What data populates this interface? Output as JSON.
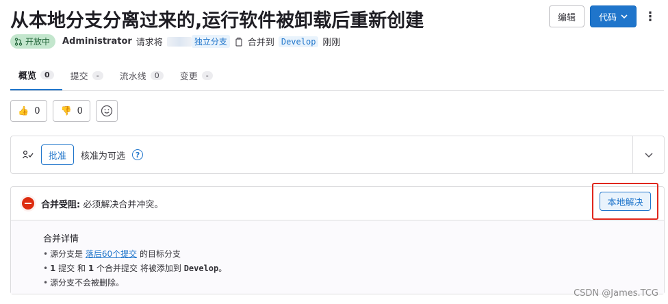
{
  "title": "从本地分支分离过来的,运行软件被卸载后重新创建",
  "header": {
    "edit_label": "编辑",
    "code_label": "代码"
  },
  "meta": {
    "status": "开放中",
    "author": "Administrator",
    "request_text": "请求将",
    "source_branch": "独立分支",
    "merge_into_text": "合并到",
    "target_branch": "Develop",
    "time": "刚刚"
  },
  "tabs": [
    {
      "label": "概览",
      "count": "0"
    },
    {
      "label": "提交",
      "count": "-"
    },
    {
      "label": "流水线",
      "count": "0"
    },
    {
      "label": "变更",
      "count": "-"
    }
  ],
  "reactions": {
    "thumbsup": "0",
    "thumbsdown": "0"
  },
  "approval": {
    "button_label": "批准",
    "text": "核准为可选"
  },
  "merge": {
    "blocked_title": "合并受阻:",
    "blocked_text": "必须解决合并冲突。",
    "resolve_label": "本地解决",
    "details_title": "合并详情",
    "line1_prefix": "源分支是",
    "line1_link": "落后60个提交",
    "line1_suffix": "的目标分支",
    "line2_part1": "1",
    "line2_part2": "提交 和",
    "line2_part3": "1",
    "line2_part4": "个合并提交 将被添加到",
    "line2_branch": "Develop",
    "line2_end": "。",
    "line3": "源分支不会被删除。"
  },
  "watermark": "CSDN @James.TCG"
}
